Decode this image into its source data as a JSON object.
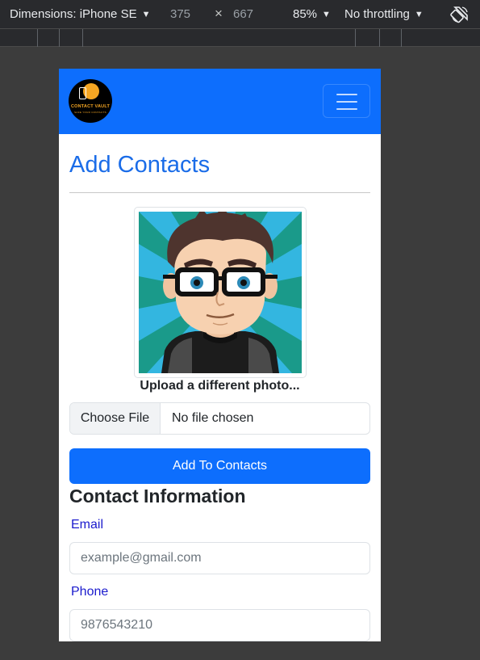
{
  "devtools": {
    "device_label": "Dimensions: iPhone SE",
    "width": "375",
    "times": "×",
    "height": "667",
    "zoom": "85%",
    "throttling": "No throttling"
  },
  "navbar": {
    "logo_brand": "CONTACT VAULT",
    "logo_tagline": "SAFE YOUR CONTACTS",
    "toggler_icon": "hamburger-icon"
  },
  "page": {
    "title": "Add Contacts",
    "upload_label": "Upload a different photo...",
    "file_button": "Choose File",
    "file_status": "No file chosen",
    "submit_label": "Add To Contacts",
    "section_title": "Contact Information"
  },
  "fields": {
    "email_label": "Email",
    "email_placeholder": "example@gmail.com",
    "phone_label": "Phone",
    "phone_placeholder": "9876543210"
  },
  "colors": {
    "primary": "#0d6efd",
    "title": "#1a6ce8",
    "field_label": "#1a1acd"
  }
}
